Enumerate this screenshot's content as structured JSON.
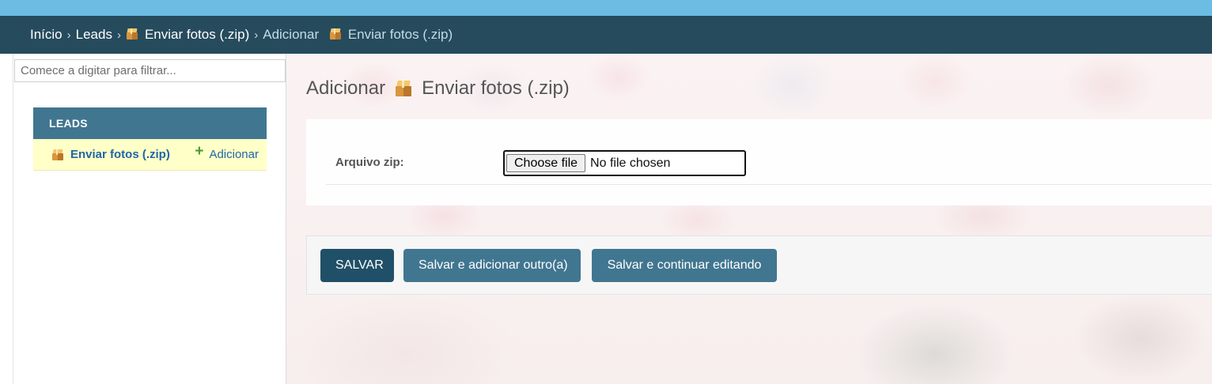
{
  "colors": {
    "top_strip": "#6cbde4",
    "header_bg": "#264b5d",
    "module_caption_bg": "#417690",
    "module_row_bg": "#ffffc8",
    "link": "#2066a8",
    "add_icon": "#4a9d2e",
    "primary_button": "#205067",
    "secondary_button": "#417690"
  },
  "breadcrumbs": {
    "home": "Início",
    "app": "Leads",
    "model": "Enviar fotos (.zip)",
    "current_prefix": "Adicionar",
    "current_model": "Enviar fotos (.zip)",
    "separator": "›",
    "model_icon": "package-icon"
  },
  "sidebar": {
    "filter_placeholder": "Comece a digitar para filtrar...",
    "module": {
      "caption": "LEADS",
      "items": [
        {
          "label": "Enviar fotos (.zip)",
          "icon": "package-icon",
          "add_label": "Adicionar",
          "add_icon": "plus-icon"
        }
      ]
    }
  },
  "main": {
    "title_prefix": "Adicionar",
    "title_model": "Enviar fotos (.zip)",
    "title_icon": "package-icon",
    "form": {
      "field_label": "Arquivo zip:",
      "file_button": "Choose file",
      "file_status": "No file chosen"
    },
    "buttons": {
      "save": "SALVAR",
      "save_add_another": "Salvar e adicionar outro(a)",
      "save_continue": "Salvar e continuar editando"
    }
  }
}
